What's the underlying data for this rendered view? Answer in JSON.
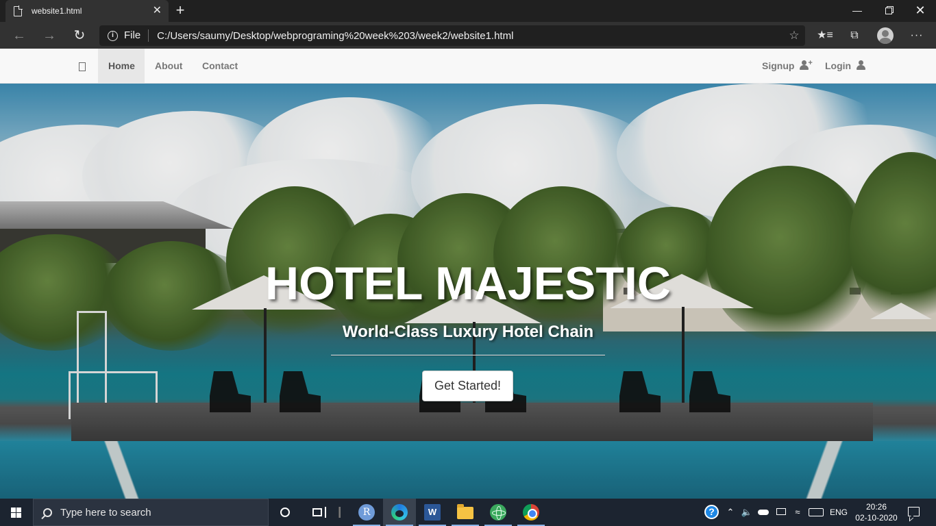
{
  "browser": {
    "tab_title": "website1.html",
    "tab_close": "✕",
    "new_tab": "+",
    "url_scheme": "File",
    "url": "C:/Users/saumy/Desktop/webprograming%20week%203/week2/website1.html",
    "icons": {
      "back": "back-arrow-icon",
      "forward": "forward-arrow-icon",
      "reload": "reload-icon",
      "info": "info-icon",
      "favorite": "star-icon",
      "favorites_bar": "favorites-icon",
      "collections": "collections-icon",
      "profile": "profile-avatar-icon",
      "more": "more-icon"
    },
    "window_controls": {
      "minimize": "—",
      "close": "✕"
    }
  },
  "site": {
    "nav": {
      "home": "Home",
      "about": "About",
      "contact": "Contact",
      "signup": "Signup",
      "login": "Login"
    },
    "hero": {
      "title": "HOTEL MAJESTIC",
      "subtitle": "World-Class Luxury Hotel Chain",
      "cta": "Get Started!"
    }
  },
  "taskbar": {
    "search_placeholder": "Type here to search",
    "pinned_apps": [
      "r-app-icon",
      "edge-icon",
      "word-icon",
      "file-explorer-icon",
      "atom-icon",
      "chrome-icon"
    ],
    "r_letter": "R",
    "word_letter": "W",
    "tray": {
      "help": "?",
      "language": "ENG",
      "time": "20:26",
      "date": "02-10-2020"
    }
  },
  "colors": {
    "taskbar_bg": "#1c2430",
    "browser_bg": "#202020",
    "nav_bg": "#f8f8f8",
    "nav_active_bg": "#e7e7e7"
  }
}
